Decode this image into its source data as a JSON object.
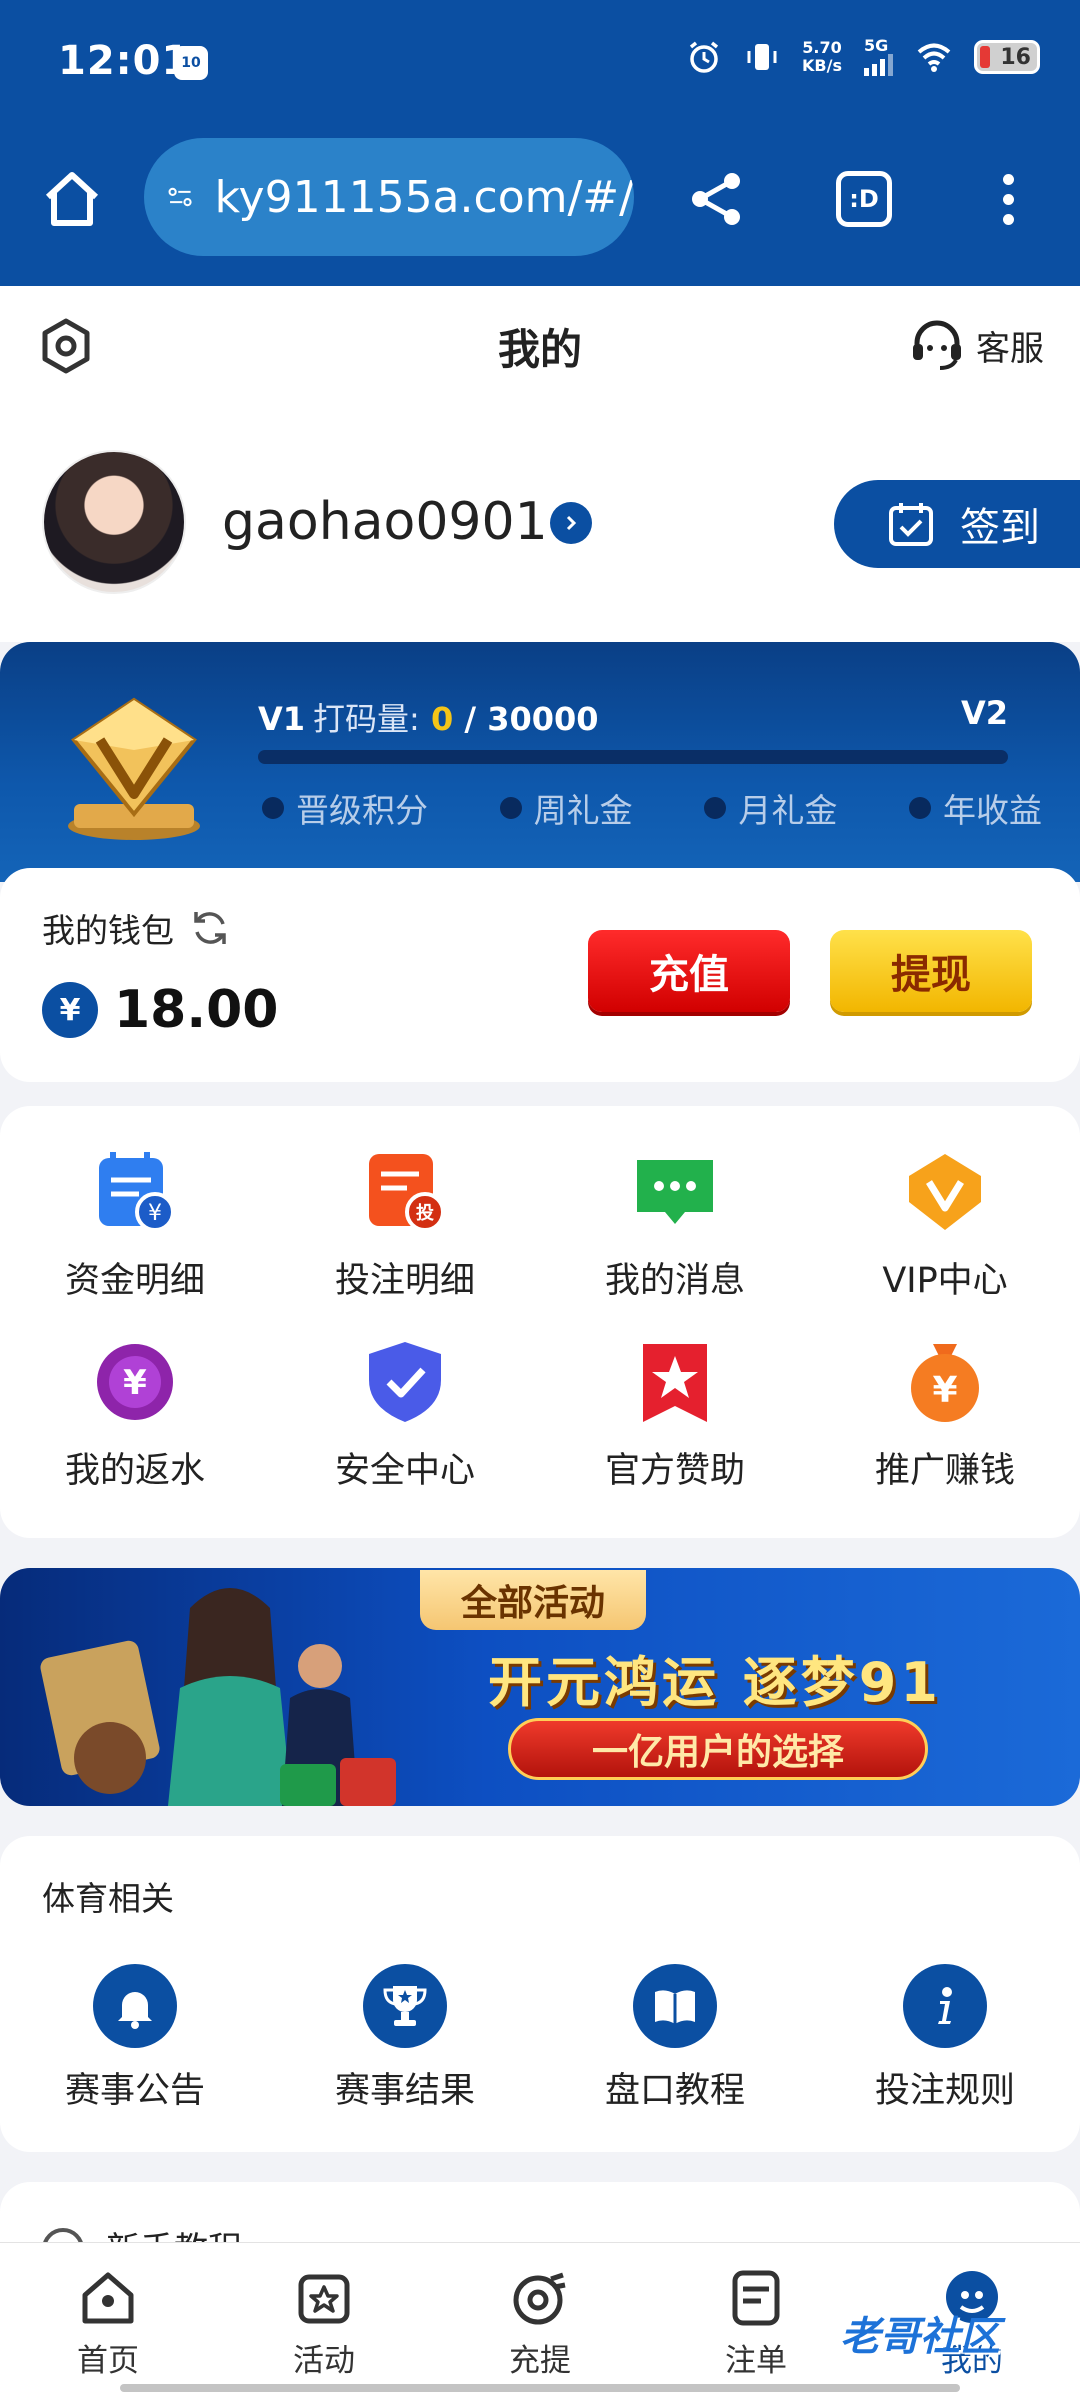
{
  "status_bar": {
    "time": "12:01",
    "app_badge": "10",
    "net_speed_value": "5.70",
    "net_speed_unit": "KB/s",
    "network": "5G",
    "battery": "16"
  },
  "browser": {
    "url": "ky911155a.com/#/",
    "tabs_label": ":D"
  },
  "header": {
    "title": "我的",
    "service_label": "客服"
  },
  "profile": {
    "username": "gaohao0901",
    "checkin_label": "签到"
  },
  "vip": {
    "level": "V1",
    "wager_label": "打码量:",
    "wager_current": "0",
    "wager_target": "/ 30000",
    "next_level": "V2",
    "progress": 0,
    "benefits": [
      "晋级积分",
      "周礼金",
      "月礼金",
      "年收益"
    ]
  },
  "wallet": {
    "title": "我的钱包",
    "currency_symbol": "¥",
    "balance": "18.00",
    "deposit_label": "充值",
    "withdraw_label": "提现"
  },
  "quick_grid": [
    {
      "label": "资金明细",
      "icon": "fund-details-icon"
    },
    {
      "label": "投注明细",
      "icon": "bet-details-icon"
    },
    {
      "label": "我的消息",
      "icon": "message-icon"
    },
    {
      "label": "VIP中心",
      "icon": "vip-center-icon"
    },
    {
      "label": "我的返水",
      "icon": "rebate-icon"
    },
    {
      "label": "安全中心",
      "icon": "shield-icon"
    },
    {
      "label": "官方赞助",
      "icon": "star-ribbon-icon"
    },
    {
      "label": "推广赚钱",
      "icon": "money-bag-icon"
    }
  ],
  "banner": {
    "tag": "全部活动",
    "title": "开元鸿运 逐梦91",
    "slogan": "一亿用户的选择"
  },
  "sports": {
    "title": "体育相关",
    "items": [
      {
        "label": "赛事公告",
        "icon": "bell-icon"
      },
      {
        "label": "赛事结果",
        "icon": "trophy-icon"
      },
      {
        "label": "盘口教程",
        "icon": "book-icon"
      },
      {
        "label": "投注规则",
        "icon": "info-icon"
      }
    ]
  },
  "next_section": {
    "label": "新手教程"
  },
  "bottom_nav": [
    {
      "label": "首页",
      "icon": "home-icon"
    },
    {
      "label": "活动",
      "icon": "activity-icon"
    },
    {
      "label": "充提",
      "icon": "deposit-withdraw-icon"
    },
    {
      "label": "注单",
      "icon": "bet-slip-icon"
    },
    {
      "label": "我的",
      "icon": "profile-icon"
    }
  ],
  "watermark": "老哥社区",
  "colors": {
    "primary": "#0b4fa2",
    "deposit": "#e00000",
    "withdraw": "#f5c518",
    "vip_highlight": "#f5c518"
  }
}
